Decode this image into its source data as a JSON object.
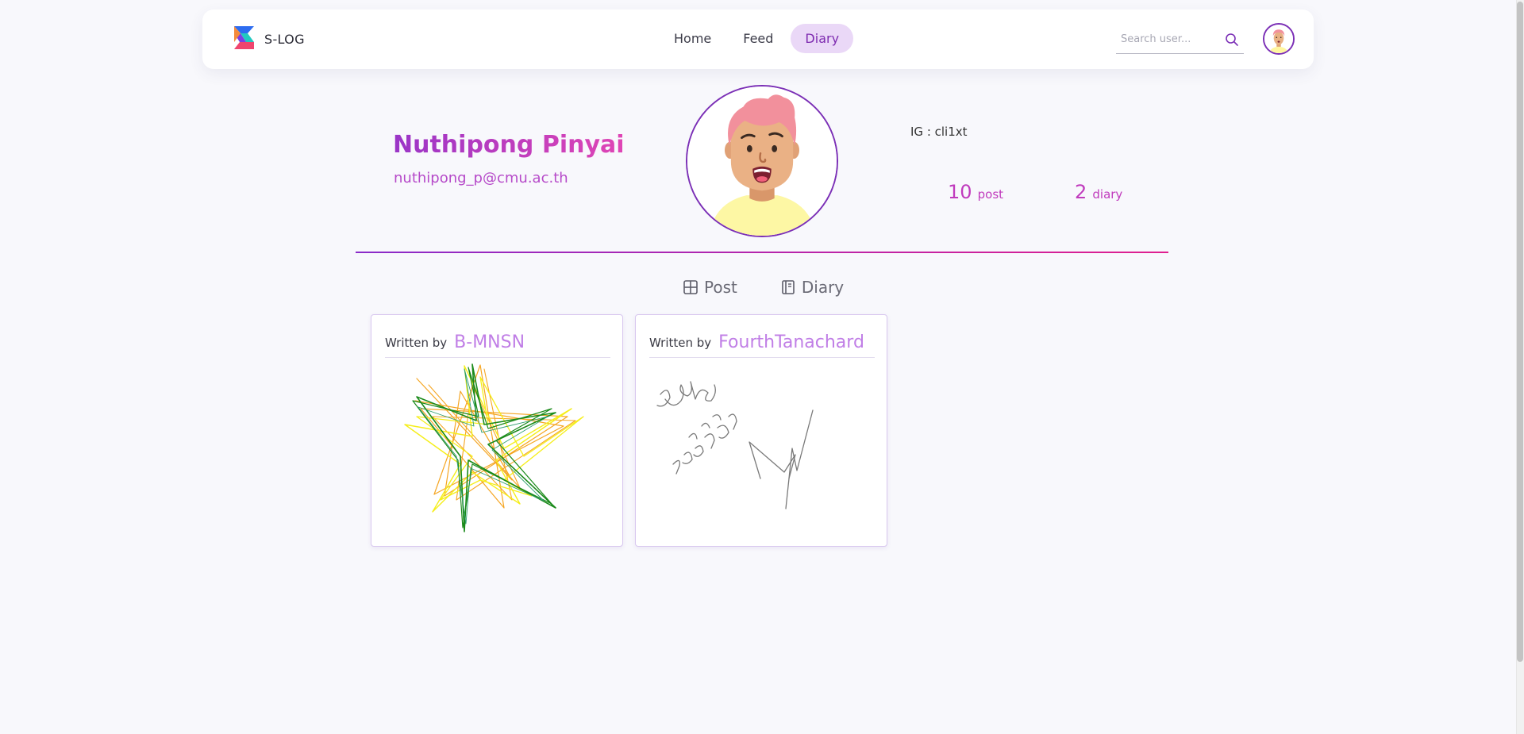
{
  "brand": {
    "name": "S-LOG"
  },
  "nav": {
    "links": [
      {
        "label": "Home"
      },
      {
        "label": "Feed"
      },
      {
        "label": "Diary"
      }
    ],
    "active": "Diary"
  },
  "search": {
    "placeholder": "Search user...",
    "value": ""
  },
  "profile": {
    "first_name": "Nuthipong",
    "last_name": "Pinyai",
    "email": "nuthipong_p@cmu.ac.th",
    "ig": "IG : cli1xt",
    "post_count": "10",
    "post_unit": "post",
    "diary_count": "2",
    "diary_unit": "diary"
  },
  "tabs": [
    {
      "label": "Post",
      "icon": "grid-icon"
    },
    {
      "label": "Diary",
      "icon": "notebook-icon"
    }
  ],
  "cards": [
    {
      "written_label": "Written by",
      "author": "B-MNSN",
      "art": "star-scribble-drawing"
    },
    {
      "written_label": "Written by",
      "author": "FourthTanachard",
      "art": "handwritten-thai-drawing"
    }
  ],
  "colors": {
    "accent_purple": "#7b2fb6",
    "accent_pink": "#e01f8f",
    "author_color": "#c07ee6",
    "active_tab_bg": "#ead8f7"
  }
}
